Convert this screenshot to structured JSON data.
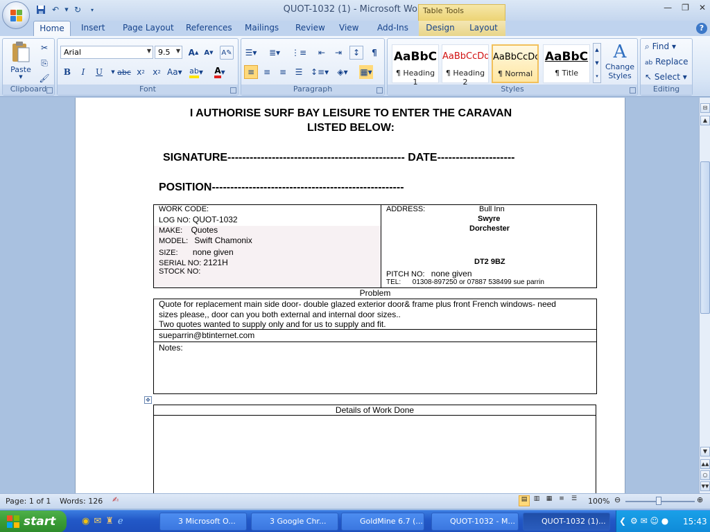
{
  "window": {
    "title": "QUOT-1032 (1) - Microsoft Word",
    "contextual_label": "Table Tools"
  },
  "tabs": [
    "Home",
    "Insert",
    "Page Layout",
    "References",
    "Mailings",
    "Review",
    "View",
    "Add-Ins",
    "Design",
    "Layout"
  ],
  "ribbon": {
    "clipboard": {
      "label": "Clipboard",
      "paste": "Paste"
    },
    "font": {
      "label": "Font",
      "family": "Arial",
      "size": "9.5"
    },
    "paragraph": {
      "label": "Paragraph"
    },
    "styles": {
      "label": "Styles",
      "items": [
        {
          "sample": "AaBbC",
          "name": "¶ Heading 1"
        },
        {
          "sample": "AaBbCcDd",
          "name": "¶ Heading 2"
        },
        {
          "sample": "AaBbCcDc",
          "name": "¶ Normal"
        },
        {
          "sample": "AaBbC",
          "name": "¶ Title"
        }
      ],
      "change_styles": "Change Styles"
    },
    "editing": {
      "label": "Editing",
      "find": "Find",
      "replace": "Replace",
      "select": "Select"
    }
  },
  "document": {
    "heading_line1": "I AUTHORISE SURF BAY LEISURE TO ENTER THE CARAVAN",
    "heading_line2": "LISTED BELOW:",
    "signature_line": "SIGNATURE------------------------------------------------ DATE---------------------",
    "position_line": "POSITION----------------------------------------------------",
    "left": {
      "work_code_label": "WORK CODE:",
      "log_label": "LOG NO:",
      "log_value": "QUOT-1032",
      "make_label": "MAKE:",
      "make_value": "Quotes",
      "model_label": "MODEL:",
      "model_value": "Swift Chamonix",
      "size_label": "SIZE:",
      "size_value": "none given",
      "serial_label": "SERIAL NO:",
      "serial_value": "2121H",
      "stock_label": "STOCK NO:"
    },
    "right": {
      "address_label": "ADDRESS:",
      "address_line1": "Bull Inn",
      "address_line2": "Swyre",
      "address_line3": "Dorchester",
      "postcode": "DT2 9BZ",
      "pitch_label": "PITCH NO:",
      "pitch_value": "none given",
      "tel_label": "TEL:",
      "tel_value": "01308-897250  or 07887 538499  sue parrin"
    },
    "problem_header": "Problem",
    "problem_line1": "Quote for replacement main side door- double glazed exterior door& frame plus front French windows- need",
    "problem_line2": "sizes please,, door can you both external and internal door sizes..",
    "problem_line3": "Two quotes wanted to supply only and for us to supply and fit.",
    "email": "sueparrin@btinternet.com",
    "notes_label": "Notes:",
    "details_header": "Details of Work Done"
  },
  "status": {
    "page": "Page: 1 of 1",
    "words": "Words: 126",
    "zoom": "100%"
  },
  "taskbar": {
    "start": "start",
    "buttons": [
      "3 Microsoft O...",
      "3 Google Chr...",
      "GoldMine 6.7 (...",
      "QUOT-1032 - M...",
      "QUOT-1032 (1)..."
    ],
    "clock": "15:43"
  }
}
